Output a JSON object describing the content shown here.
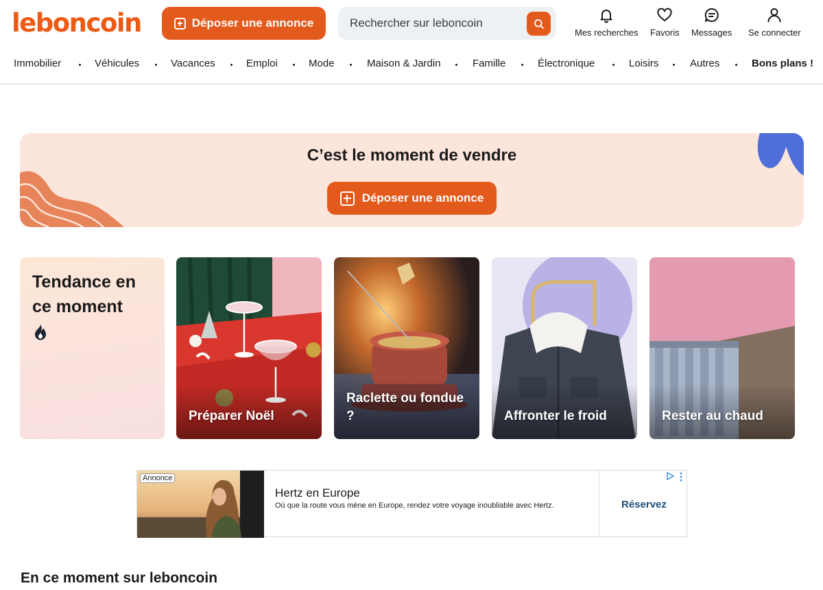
{
  "header": {
    "logo": "leboncoin",
    "post_button": "Déposer une annonce",
    "search_placeholder": "Rechercher sur leboncoin",
    "icons": {
      "searches": "Mes recherches",
      "favorites": "Favoris",
      "messages": "Messages",
      "login": "Se connecter"
    }
  },
  "nav": [
    "Immobilier",
    "Véhicules",
    "Vacances",
    "Emploi",
    "Mode",
    "Maison & Jardin",
    "Famille",
    "Électronique",
    "Loisirs",
    "Autres",
    "Bons plans !"
  ],
  "banner": {
    "title": "C’est le moment de vendre",
    "button": "Déposer une annonce"
  },
  "trending": {
    "title": "Tendance en ce moment",
    "tiles": [
      "Préparer Noël",
      "Raclette ou fondue ?",
      "Affronter le froid",
      "Rester au chaud"
    ]
  },
  "ad": {
    "tag": "Annonce",
    "title": "Hertz en Europe",
    "description": "Où que la route vous mène en Europe, rendez votre voyage inoubliable avec Hertz.",
    "cta": "Réservez"
  },
  "section_title": "En ce moment sur leboncoin",
  "colors": {
    "brand": "#ec5a13",
    "button": "#e35a1d",
    "banner_bg": "#fce6dc"
  }
}
